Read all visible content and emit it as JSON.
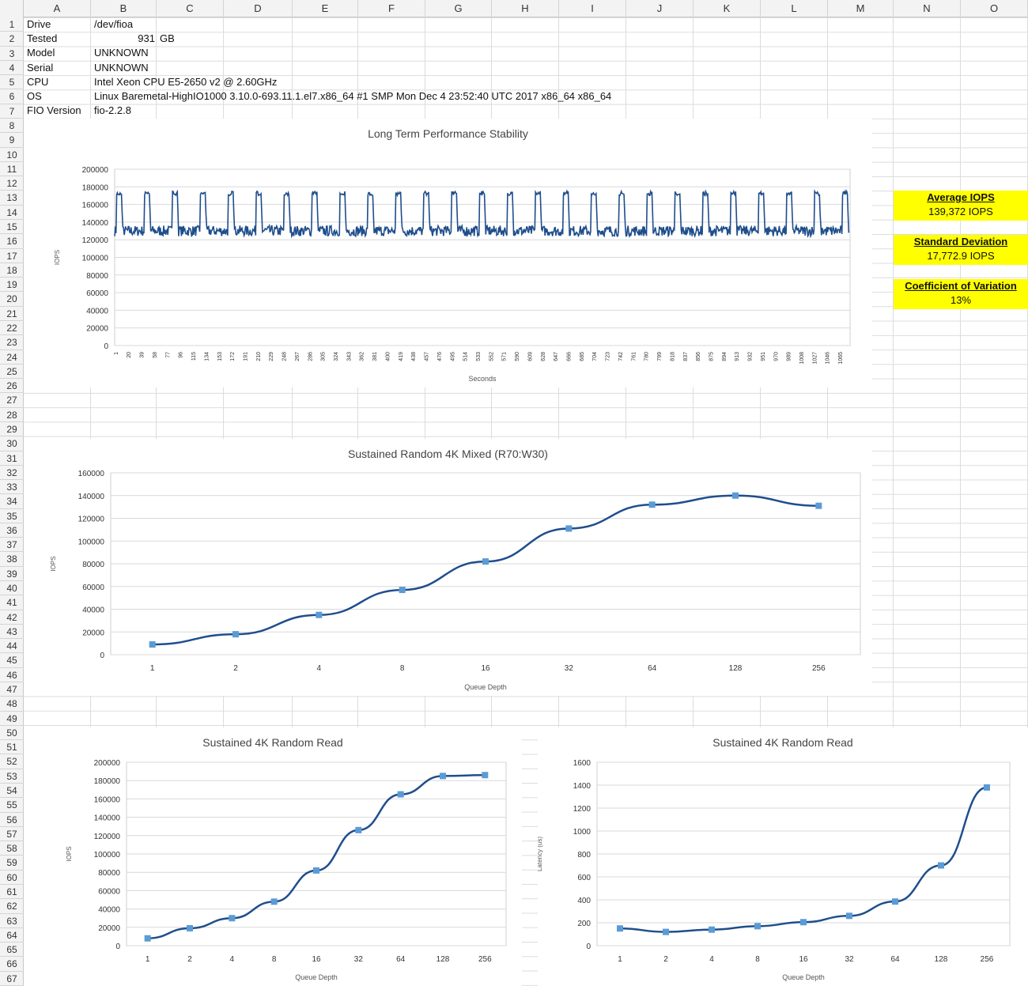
{
  "columns": [
    "A",
    "B",
    "C",
    "D",
    "E",
    "F",
    "G",
    "H",
    "I",
    "J",
    "K",
    "L",
    "M",
    "N",
    "O"
  ],
  "row_count": 67,
  "cells": {
    "r1": {
      "label": "Drive",
      "value": "/dev/fioa"
    },
    "r2": {
      "label": "Tested",
      "value": "931",
      "unit": "GB"
    },
    "r3": {
      "label": "Model",
      "value": "UNKNOWN"
    },
    "r4": {
      "label": "Serial",
      "value": "UNKNOWN"
    },
    "r5": {
      "label": "CPU",
      "value": "Intel Xeon CPU E5-2650 v2 @ 2.60GHz"
    },
    "r6": {
      "label": "OS",
      "value": "Linux Baremetal-HighIO1000 3.10.0-693.11.1.el7.x86_64 #1 SMP Mon Dec 4 23:52:40 UTC 2017 x86_64 x86_64"
    },
    "r7": {
      "label": "FIO Version",
      "value": "fio-2.2.8"
    }
  },
  "stats": {
    "avg_title": "Average IOPS",
    "avg_value": "139,372  IOPS",
    "sd_title": "Standard Deviation",
    "sd_value": "17,772.9  IOPS",
    "cv_title": "Coefficient of Variation",
    "cv_value": "13%"
  },
  "colors": {
    "line": "#1f4e8c",
    "marker": "#5b9bd5",
    "highlight": "#ffff00"
  },
  "chart_data": [
    {
      "type": "line",
      "title": "Long Term Performance Stability",
      "xlabel": "Seconds",
      "ylabel": "IOPS",
      "ylim": [
        0,
        200000
      ],
      "yticks": [
        0,
        20000,
        40000,
        60000,
        80000,
        100000,
        120000,
        140000,
        160000,
        180000,
        200000
      ],
      "xticks": [
        "1",
        "20",
        "39",
        "58",
        "77",
        "96",
        "115",
        "134",
        "153",
        "172",
        "191",
        "210",
        "229",
        "248",
        "267",
        "286",
        "305",
        "324",
        "343",
        "362",
        "381",
        "400",
        "419",
        "438",
        "457",
        "476",
        "495",
        "514",
        "533",
        "552",
        "571",
        "590",
        "609",
        "628",
        "647",
        "666",
        "685",
        "704",
        "723",
        "742",
        "761",
        "780",
        "799",
        "818",
        "837",
        "856",
        "875",
        "894",
        "913",
        "932",
        "951",
        "970",
        "989",
        "1008",
        "1027",
        "1046",
        "1065"
      ],
      "series_profile": {
        "seconds": 1080,
        "baseline": 130000,
        "noise": 6000,
        "spike_peak": 175000,
        "spike_period": 41,
        "spike_width": 8,
        "spike_count": 26
      }
    },
    {
      "type": "line",
      "title": "Sustained Random 4K Mixed (R70:W30)",
      "xlabel": "Queue Depth",
      "ylabel": "IOPS",
      "ylim": [
        0,
        160000
      ],
      "yticks": [
        0,
        20000,
        40000,
        60000,
        80000,
        100000,
        120000,
        140000,
        160000
      ],
      "categories": [
        "1",
        "2",
        "4",
        "8",
        "16",
        "32",
        "64",
        "128",
        "256"
      ],
      "values": [
        9000,
        18000,
        35000,
        57000,
        82000,
        111000,
        132000,
        140000,
        131000
      ]
    },
    {
      "type": "line",
      "title": "Sustained 4K Random Read",
      "xlabel": "Queue Depth",
      "ylabel": "IOPS",
      "ylim": [
        0,
        200000
      ],
      "yticks": [
        0,
        20000,
        40000,
        60000,
        80000,
        100000,
        120000,
        140000,
        160000,
        180000,
        200000
      ],
      "categories": [
        "1",
        "2",
        "4",
        "8",
        "16",
        "32",
        "64",
        "128",
        "256"
      ],
      "values": [
        8000,
        19000,
        30000,
        48000,
        82000,
        126000,
        165000,
        185000,
        186000
      ]
    },
    {
      "type": "line",
      "title": "Sustained 4K Random Read",
      "xlabel": "Queue Depth",
      "ylabel": "Latency (us)",
      "ylim": [
        0,
        1600
      ],
      "yticks": [
        0,
        200,
        400,
        600,
        800,
        1000,
        1200,
        1400,
        1600
      ],
      "categories": [
        "1",
        "2",
        "4",
        "8",
        "16",
        "32",
        "64",
        "128",
        "256"
      ],
      "values": [
        150,
        120,
        140,
        170,
        205,
        260,
        385,
        700,
        1380
      ]
    }
  ]
}
